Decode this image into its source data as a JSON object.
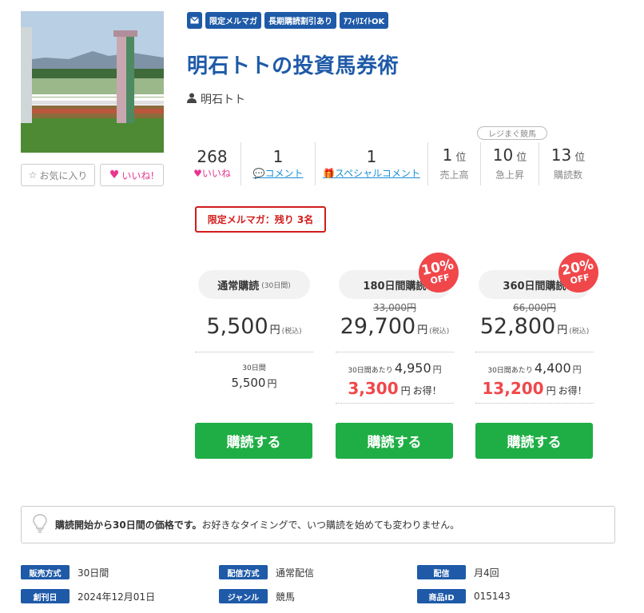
{
  "tags": {
    "limited": "限定メルマガ",
    "long_discount": "長期購読割引あり",
    "affiliate": "ｱﾌｨﾘｴｲﾄOK"
  },
  "title": "明石トトの投資馬券術",
  "author": "明石トト",
  "buttons": {
    "favorite": "お気に入り",
    "like": "いいね!"
  },
  "stats": [
    {
      "value": "268",
      "label": "いいね"
    },
    {
      "value": "1",
      "label": "コメント"
    },
    {
      "value": "1",
      "label": "スペシャルコメント"
    }
  ],
  "ranks": {
    "badge": "レジまぐ競馬",
    "unit": "位",
    "items": [
      {
        "value": "1",
        "label": "売上高"
      },
      {
        "value": "10",
        "label": "急上昇"
      },
      {
        "value": "13",
        "label": "購読数"
      }
    ]
  },
  "limited_notice": "限定メルマガ：残り 3名",
  "plans": [
    {
      "name": "通常購読",
      "name_sub": "(30日間)",
      "price": "5,500",
      "yen": "円",
      "tax": "(税込)",
      "per_label": "30日間",
      "per_price": "5,500",
      "buy": "購読する"
    },
    {
      "name": "180日間購読",
      "discount": "10%",
      "off": "OFF",
      "original": "33,000円",
      "price": "29,700",
      "yen": "円",
      "tax": "(税込)",
      "per_label": "30日間あたり",
      "per_price": "4,950",
      "save": "3,300",
      "save_suffix": "お得！",
      "buy": "購読する"
    },
    {
      "name": "360日間購読",
      "discount": "20%",
      "off": "OFF",
      "original": "66,000円",
      "price": "52,800",
      "yen": "円",
      "tax": "(税込)",
      "per_label": "30日間あたり",
      "per_price": "4,400",
      "save": "13,200",
      "save_suffix": "お得！",
      "buy": "購読する"
    }
  ],
  "notice": {
    "bold": "購読開始から30日間の価格です。",
    "text": "お好きなタイミングで、いつ購読を始めても変わりません。"
  },
  "info": [
    {
      "key": "販売方式",
      "value": "30日間"
    },
    {
      "key": "配信方式",
      "value": "通常配信"
    },
    {
      "key": "配信",
      "value": "月4回"
    },
    {
      "key": "創刊日",
      "value": "2024年12月01日"
    },
    {
      "key": "ジャンル",
      "value": "競馬"
    },
    {
      "key": "商品ID",
      "value": "015143"
    }
  ]
}
